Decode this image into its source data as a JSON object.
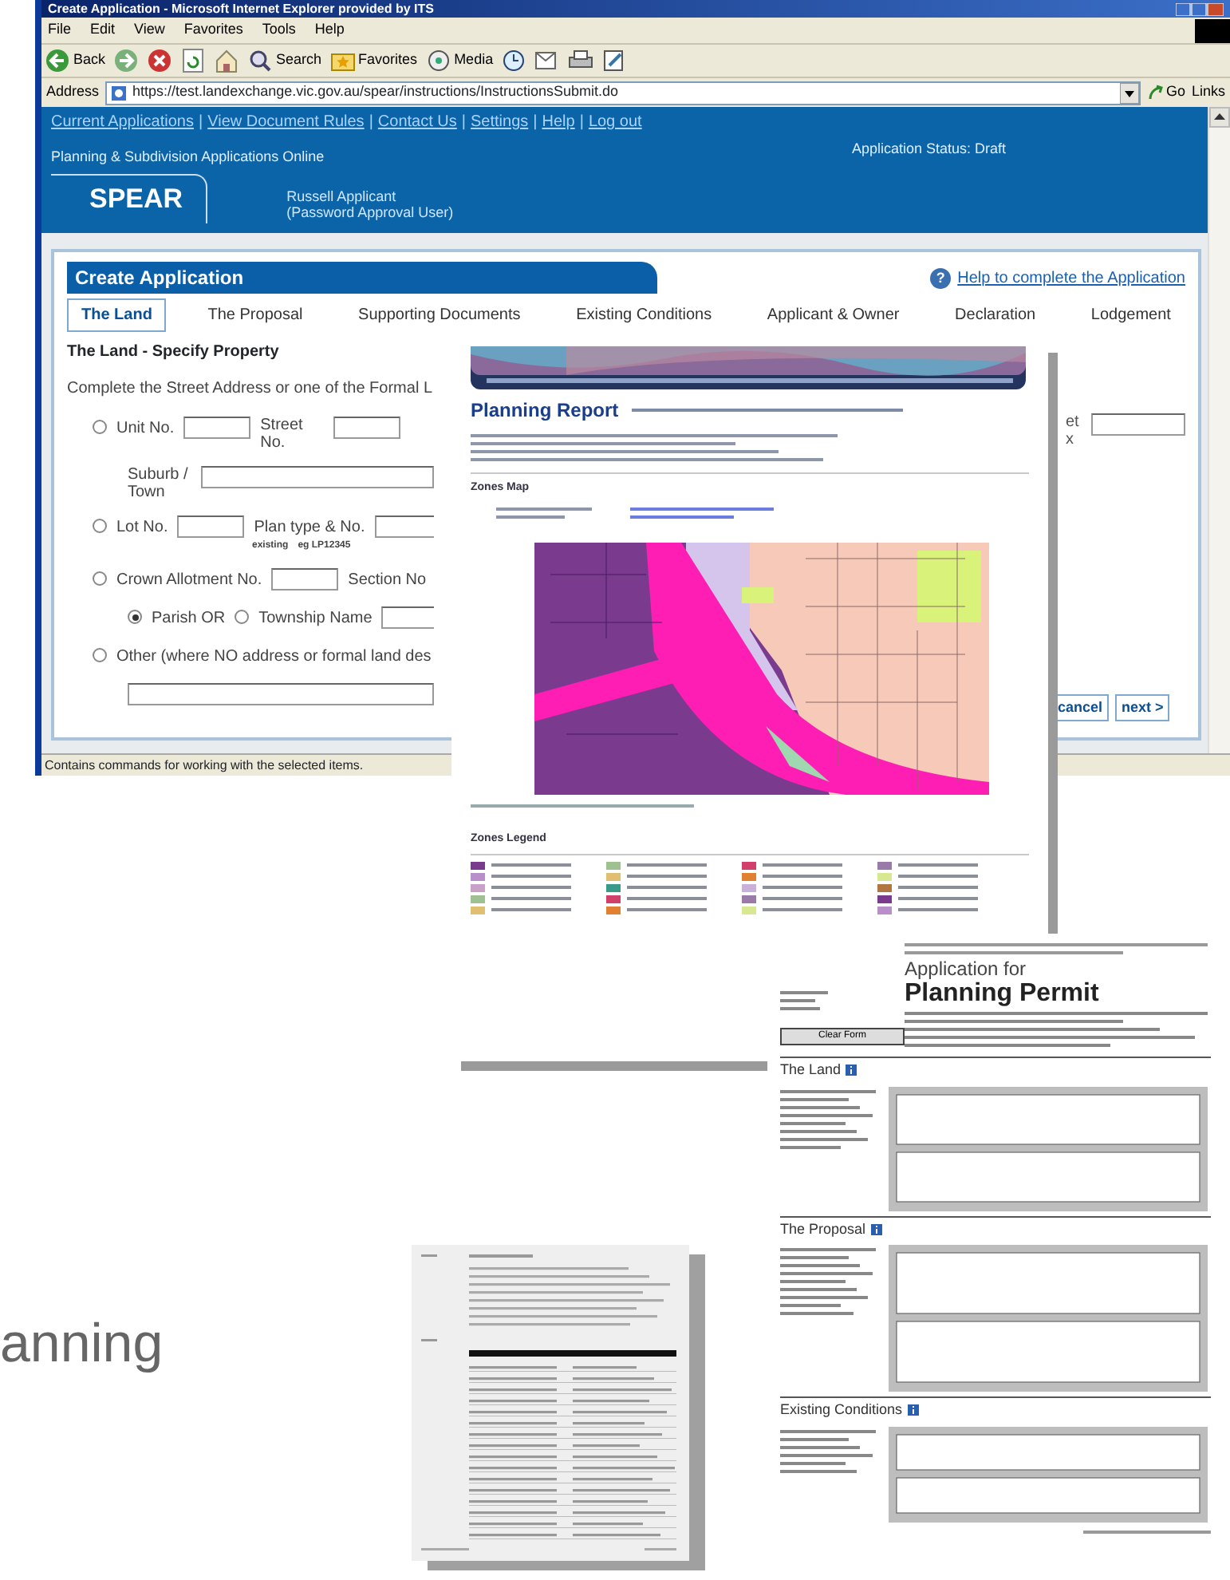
{
  "browser": {
    "title": "Create Application - Microsoft Internet Explorer provided by ITS",
    "menu": [
      "File",
      "Edit",
      "View",
      "Favorites",
      "Tools",
      "Help"
    ],
    "toolbar": [
      {
        "kind": "back",
        "label": "Back"
      },
      {
        "kind": "forward"
      },
      {
        "kind": "stop"
      },
      {
        "kind": "refresh"
      },
      {
        "kind": "home"
      },
      {
        "kind": "search",
        "label": "Search"
      },
      {
        "kind": "favorites",
        "label": "Favorites"
      },
      {
        "kind": "media",
        "label": "Media"
      },
      {
        "kind": "history"
      },
      {
        "kind": "mail"
      },
      {
        "kind": "print"
      },
      {
        "kind": "edit"
      }
    ],
    "address_label": "Address",
    "url": "https://test.landexchange.vic.gov.au/spear/instructions/InstructionsSubmit.do",
    "go": "Go",
    "links": "Links",
    "status_bar": "Contains commands for working with the selected items."
  },
  "site": {
    "nav_links": [
      "Current Applications",
      "View Document Rules",
      "Contact Us",
      "Settings",
      "Help",
      "Log out"
    ],
    "nav_separators": [
      "|",
      "|",
      "|",
      "|",
      "|"
    ],
    "subtitle": "Planning & Subdivision Applications Online",
    "status": "Application Status: Draft",
    "logo": "SPEAR",
    "user_name": "Russell  Applicant",
    "user_role": "(Password Approval User)"
  },
  "panel": {
    "title": "Create Application",
    "help_icon": "?",
    "help_link": "Help to complete the Application",
    "tabs": [
      {
        "label": "The Land",
        "selected": true
      },
      {
        "label": "The Proposal",
        "selected": false
      },
      {
        "label": "Supporting Documents",
        "selected": false
      },
      {
        "label": "Existing Conditions",
        "selected": false
      },
      {
        "label": "Applicant & Owner",
        "selected": false
      },
      {
        "label": "Declaration",
        "selected": false
      },
      {
        "label": "Lodgement",
        "selected": false
      }
    ],
    "section_title": "The Land - Specify Property",
    "instructions": "Complete the Street Address or one of the Formal L",
    "form_rows": [
      {
        "kind": "option",
        "items": [
          {
            "kind": "radio",
            "selected": false
          },
          {
            "kind": "label",
            "text": "Unit No."
          },
          {
            "kind": "input"
          },
          {
            "kind": "stacked-label",
            "text": "Street No."
          },
          {
            "kind": "input"
          }
        ]
      },
      {
        "kind": "indented",
        "items": [
          {
            "kind": "stacked-label",
            "text": "Suburb / Town"
          },
          {
            "kind": "wide-input"
          }
        ]
      },
      {
        "kind": "option",
        "items": [
          {
            "kind": "radio",
            "selected": false
          },
          {
            "kind": "label",
            "text": "Lot No."
          },
          {
            "kind": "input"
          },
          {
            "kind": "label",
            "text": "Plan type & No."
          },
          {
            "kind": "wide-input"
          }
        ]
      },
      {
        "kind": "hints",
        "items": [
          {
            "kind": "hint",
            "text": "existing"
          },
          {
            "kind": "hint",
            "text": "eg LP12345"
          }
        ]
      },
      {
        "kind": "option",
        "items": [
          {
            "kind": "radio",
            "selected": false
          },
          {
            "kind": "label",
            "text": "Crown Allotment No."
          },
          {
            "kind": "input"
          },
          {
            "kind": "label",
            "text": "Section No"
          }
        ]
      },
      {
        "kind": "indented",
        "items": [
          {
            "kind": "radio",
            "selected": true
          },
          {
            "kind": "label",
            "text": "Parish OR"
          },
          {
            "kind": "radio",
            "selected": false
          },
          {
            "kind": "label",
            "text": "Township Name"
          },
          {
            "kind": "wide-input"
          }
        ]
      },
      {
        "kind": "option",
        "items": [
          {
            "kind": "radio",
            "selected": false
          },
          {
            "kind": "label",
            "text": "Other (where NO address or formal land des"
          }
        ]
      },
      {
        "kind": "indented",
        "items": [
          {
            "kind": "wide-input"
          }
        ]
      }
    ],
    "right_fragments": [
      "et",
      "x"
    ],
    "buttons": [
      "cancel",
      "next >"
    ]
  },
  "documents": [
    {
      "kind": "report",
      "title": "Planning Report",
      "headings": [
        "Zones Map",
        "Zones Legend"
      ]
    },
    {
      "kind": "permit",
      "title_top": "Application for",
      "title_main": "Planning Permit",
      "clear_button": "Clear Form",
      "sections": [
        "The Land",
        "The Proposal",
        "Existing Conditions"
      ]
    },
    {
      "kind": "plain"
    }
  ],
  "slide_text": "anning"
}
